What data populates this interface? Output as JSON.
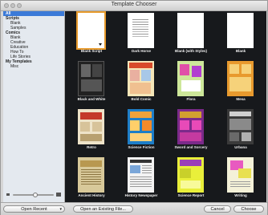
{
  "window": {
    "title": "Template Chooser"
  },
  "sidebar": {
    "selected": "All",
    "groups": [
      {
        "label": "Scripts",
        "items": [
          "Blank",
          "Samples"
        ]
      },
      {
        "label": "Comics",
        "items": [
          "Blank",
          "Creative",
          "Education",
          "How To",
          "Life Stories"
        ]
      },
      {
        "label": "My Templates",
        "items": [
          "Misc"
        ]
      }
    ]
  },
  "zoom": {
    "level_fraction": 0.55
  },
  "templates": [
    {
      "label": "Blank Script"
    },
    {
      "label": "Dark Horse"
    },
    {
      "label": "Blank (with Styles)"
    },
    {
      "label": "Blank"
    },
    {
      "label": "Black and White"
    },
    {
      "label": "Bold Comic"
    },
    {
      "label": "Flora"
    },
    {
      "label": "Mesa"
    },
    {
      "label": "Retro"
    },
    {
      "label": "Science Fiction"
    },
    {
      "label": "Sword and Sorcery"
    },
    {
      "label": "Urbana"
    },
    {
      "label": "Ancient History"
    },
    {
      "label": "History Newspaper"
    },
    {
      "label": "Science Report"
    },
    {
      "label": "Writing"
    }
  ],
  "buttons": {
    "open_recent": "Open Recent",
    "open_existing": "Open an Existing File...",
    "cancel": "Cancel",
    "choose": "Choose"
  }
}
